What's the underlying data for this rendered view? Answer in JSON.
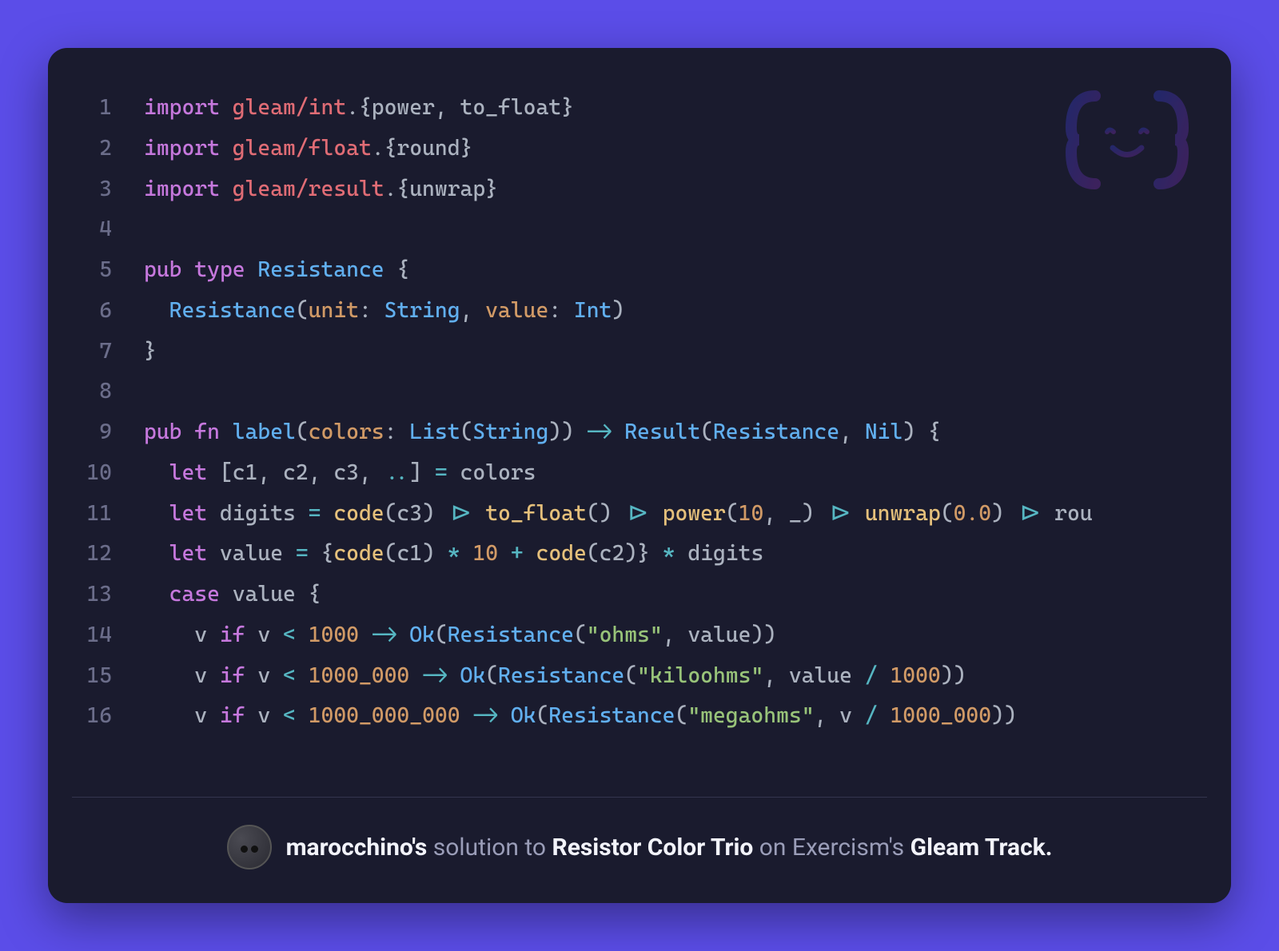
{
  "code": {
    "lines": [
      {
        "n": 1,
        "tokens": [
          {
            "c": "tok-keyword",
            "t": "import"
          },
          {
            "c": "tok-ident",
            "t": " "
          },
          {
            "c": "tok-module",
            "t": "gleam/int"
          },
          {
            "c": "tok-punct",
            "t": ".{"
          },
          {
            "c": "tok-ident",
            "t": "power"
          },
          {
            "c": "tok-punct",
            "t": ", "
          },
          {
            "c": "tok-ident",
            "t": "to_float"
          },
          {
            "c": "tok-punct",
            "t": "}"
          }
        ]
      },
      {
        "n": 2,
        "tokens": [
          {
            "c": "tok-keyword",
            "t": "import"
          },
          {
            "c": "tok-ident",
            "t": " "
          },
          {
            "c": "tok-module",
            "t": "gleam/float"
          },
          {
            "c": "tok-punct",
            "t": ".{"
          },
          {
            "c": "tok-ident",
            "t": "round"
          },
          {
            "c": "tok-punct",
            "t": "}"
          }
        ]
      },
      {
        "n": 3,
        "tokens": [
          {
            "c": "tok-keyword",
            "t": "import"
          },
          {
            "c": "tok-ident",
            "t": " "
          },
          {
            "c": "tok-module",
            "t": "gleam/result"
          },
          {
            "c": "tok-punct",
            "t": ".{"
          },
          {
            "c": "tok-ident",
            "t": "unwrap"
          },
          {
            "c": "tok-punct",
            "t": "}"
          }
        ]
      },
      {
        "n": 4,
        "tokens": []
      },
      {
        "n": 5,
        "tokens": [
          {
            "c": "tok-keyword",
            "t": "pub"
          },
          {
            "c": "tok-ident",
            "t": " "
          },
          {
            "c": "tok-keyword",
            "t": "type"
          },
          {
            "c": "tok-ident",
            "t": " "
          },
          {
            "c": "tok-type",
            "t": "Resistance"
          },
          {
            "c": "tok-ident",
            "t": " "
          },
          {
            "c": "tok-punct",
            "t": "{"
          }
        ]
      },
      {
        "n": 6,
        "tokens": [
          {
            "c": "tok-ident",
            "t": "  "
          },
          {
            "c": "tok-type",
            "t": "Resistance"
          },
          {
            "c": "tok-punct",
            "t": "("
          },
          {
            "c": "tok-param",
            "t": "unit"
          },
          {
            "c": "tok-punct",
            "t": ": "
          },
          {
            "c": "tok-type",
            "t": "String"
          },
          {
            "c": "tok-punct",
            "t": ", "
          },
          {
            "c": "tok-param",
            "t": "value"
          },
          {
            "c": "tok-punct",
            "t": ": "
          },
          {
            "c": "tok-type",
            "t": "Int"
          },
          {
            "c": "tok-punct",
            "t": ")"
          }
        ]
      },
      {
        "n": 7,
        "tokens": [
          {
            "c": "tok-punct",
            "t": "}"
          }
        ]
      },
      {
        "n": 8,
        "tokens": []
      },
      {
        "n": 9,
        "tokens": [
          {
            "c": "tok-keyword",
            "t": "pub"
          },
          {
            "c": "tok-ident",
            "t": " "
          },
          {
            "c": "tok-keyword",
            "t": "fn"
          },
          {
            "c": "tok-ident",
            "t": " "
          },
          {
            "c": "tok-func",
            "t": "label"
          },
          {
            "c": "tok-punct",
            "t": "("
          },
          {
            "c": "tok-param",
            "t": "colors"
          },
          {
            "c": "tok-punct",
            "t": ": "
          },
          {
            "c": "tok-type",
            "t": "List"
          },
          {
            "c": "tok-punct",
            "t": "("
          },
          {
            "c": "tok-type",
            "t": "String"
          },
          {
            "c": "tok-punct",
            "t": ")) "
          },
          {
            "c": "tok-op",
            "t": "->"
          },
          {
            "c": "tok-ident",
            "t": " "
          },
          {
            "c": "tok-type",
            "t": "Result"
          },
          {
            "c": "tok-punct",
            "t": "("
          },
          {
            "c": "tok-type",
            "t": "Resistance"
          },
          {
            "c": "tok-punct",
            "t": ", "
          },
          {
            "c": "tok-type",
            "t": "Nil"
          },
          {
            "c": "tok-punct",
            "t": ") {"
          }
        ]
      },
      {
        "n": 10,
        "tokens": [
          {
            "c": "tok-ident",
            "t": "  "
          },
          {
            "c": "tok-keyword",
            "t": "let"
          },
          {
            "c": "tok-ident",
            "t": " "
          },
          {
            "c": "tok-punct",
            "t": "["
          },
          {
            "c": "tok-ident",
            "t": "c1"
          },
          {
            "c": "tok-punct",
            "t": ", "
          },
          {
            "c": "tok-ident",
            "t": "c2"
          },
          {
            "c": "tok-punct",
            "t": ", "
          },
          {
            "c": "tok-ident",
            "t": "c3"
          },
          {
            "c": "tok-punct",
            "t": ", "
          },
          {
            "c": "tok-op",
            "t": ".."
          },
          {
            "c": "tok-punct",
            "t": "] "
          },
          {
            "c": "tok-op",
            "t": "="
          },
          {
            "c": "tok-ident",
            "t": " colors"
          }
        ]
      },
      {
        "n": 11,
        "tokens": [
          {
            "c": "tok-ident",
            "t": "  "
          },
          {
            "c": "tok-keyword",
            "t": "let"
          },
          {
            "c": "tok-ident",
            "t": " digits "
          },
          {
            "c": "tok-op",
            "t": "="
          },
          {
            "c": "tok-ident",
            "t": " "
          },
          {
            "c": "tok-call",
            "t": "code"
          },
          {
            "c": "tok-punct",
            "t": "(c3) "
          },
          {
            "c": "tok-op",
            "t": "|>"
          },
          {
            "c": "tok-ident",
            "t": " "
          },
          {
            "c": "tok-call",
            "t": "to_float"
          },
          {
            "c": "tok-punct",
            "t": "() "
          },
          {
            "c": "tok-op",
            "t": "|>"
          },
          {
            "c": "tok-ident",
            "t": " "
          },
          {
            "c": "tok-call",
            "t": "power"
          },
          {
            "c": "tok-punct",
            "t": "("
          },
          {
            "c": "tok-num",
            "t": "10"
          },
          {
            "c": "tok-punct",
            "t": ", _) "
          },
          {
            "c": "tok-op",
            "t": "|>"
          },
          {
            "c": "tok-ident",
            "t": " "
          },
          {
            "c": "tok-call",
            "t": "unwrap"
          },
          {
            "c": "tok-punct",
            "t": "("
          },
          {
            "c": "tok-num",
            "t": "0.0"
          },
          {
            "c": "tok-punct",
            "t": ") "
          },
          {
            "c": "tok-op",
            "t": "|>"
          },
          {
            "c": "tok-ident",
            "t": " rou"
          }
        ]
      },
      {
        "n": 12,
        "tokens": [
          {
            "c": "tok-ident",
            "t": "  "
          },
          {
            "c": "tok-keyword",
            "t": "let"
          },
          {
            "c": "tok-ident",
            "t": " value "
          },
          {
            "c": "tok-op",
            "t": "="
          },
          {
            "c": "tok-ident",
            "t": " "
          },
          {
            "c": "tok-punct",
            "t": "{"
          },
          {
            "c": "tok-call",
            "t": "code"
          },
          {
            "c": "tok-punct",
            "t": "(c1) "
          },
          {
            "c": "tok-op",
            "t": "*"
          },
          {
            "c": "tok-ident",
            "t": " "
          },
          {
            "c": "tok-num",
            "t": "10"
          },
          {
            "c": "tok-ident",
            "t": " "
          },
          {
            "c": "tok-op",
            "t": "+"
          },
          {
            "c": "tok-ident",
            "t": " "
          },
          {
            "c": "tok-call",
            "t": "code"
          },
          {
            "c": "tok-punct",
            "t": "(c2)} "
          },
          {
            "c": "tok-op",
            "t": "*"
          },
          {
            "c": "tok-ident",
            "t": " digits"
          }
        ]
      },
      {
        "n": 13,
        "tokens": [
          {
            "c": "tok-ident",
            "t": "  "
          },
          {
            "c": "tok-keyword",
            "t": "case"
          },
          {
            "c": "tok-ident",
            "t": " value "
          },
          {
            "c": "tok-punct",
            "t": "{"
          }
        ]
      },
      {
        "n": 14,
        "tokens": [
          {
            "c": "tok-ident",
            "t": "    v "
          },
          {
            "c": "tok-keyword",
            "t": "if"
          },
          {
            "c": "tok-ident",
            "t": " v "
          },
          {
            "c": "tok-op",
            "t": "<"
          },
          {
            "c": "tok-ident",
            "t": " "
          },
          {
            "c": "tok-num",
            "t": "1000"
          },
          {
            "c": "tok-ident",
            "t": " "
          },
          {
            "c": "tok-op",
            "t": "->"
          },
          {
            "c": "tok-ident",
            "t": " "
          },
          {
            "c": "tok-type",
            "t": "Ok"
          },
          {
            "c": "tok-punct",
            "t": "("
          },
          {
            "c": "tok-type",
            "t": "Resistance"
          },
          {
            "c": "tok-punct",
            "t": "("
          },
          {
            "c": "tok-str",
            "t": "\"ohms\""
          },
          {
            "c": "tok-punct",
            "t": ", value))"
          }
        ]
      },
      {
        "n": 15,
        "tokens": [
          {
            "c": "tok-ident",
            "t": "    v "
          },
          {
            "c": "tok-keyword",
            "t": "if"
          },
          {
            "c": "tok-ident",
            "t": " v "
          },
          {
            "c": "tok-op",
            "t": "<"
          },
          {
            "c": "tok-ident",
            "t": " "
          },
          {
            "c": "tok-num",
            "t": "1000_000"
          },
          {
            "c": "tok-ident",
            "t": " "
          },
          {
            "c": "tok-op",
            "t": "->"
          },
          {
            "c": "tok-ident",
            "t": " "
          },
          {
            "c": "tok-type",
            "t": "Ok"
          },
          {
            "c": "tok-punct",
            "t": "("
          },
          {
            "c": "tok-type",
            "t": "Resistance"
          },
          {
            "c": "tok-punct",
            "t": "("
          },
          {
            "c": "tok-str",
            "t": "\"kiloohms\""
          },
          {
            "c": "tok-punct",
            "t": ", value "
          },
          {
            "c": "tok-op",
            "t": "/"
          },
          {
            "c": "tok-ident",
            "t": " "
          },
          {
            "c": "tok-num",
            "t": "1000"
          },
          {
            "c": "tok-punct",
            "t": "))"
          }
        ]
      },
      {
        "n": 16,
        "tokens": [
          {
            "c": "tok-ident",
            "t": "    v "
          },
          {
            "c": "tok-keyword",
            "t": "if"
          },
          {
            "c": "tok-ident",
            "t": " v "
          },
          {
            "c": "tok-op",
            "t": "<"
          },
          {
            "c": "tok-ident",
            "t": " "
          },
          {
            "c": "tok-num",
            "t": "1000_000_000"
          },
          {
            "c": "tok-ident",
            "t": " "
          },
          {
            "c": "tok-op",
            "t": "->"
          },
          {
            "c": "tok-ident",
            "t": " "
          },
          {
            "c": "tok-type",
            "t": "Ok"
          },
          {
            "c": "tok-punct",
            "t": "("
          },
          {
            "c": "tok-type",
            "t": "Resistance"
          },
          {
            "c": "tok-punct",
            "t": "("
          },
          {
            "c": "tok-str",
            "t": "\"megaohms\""
          },
          {
            "c": "tok-punct",
            "t": ", v "
          },
          {
            "c": "tok-op",
            "t": "/"
          },
          {
            "c": "tok-ident",
            "t": " "
          },
          {
            "c": "tok-num",
            "t": "1000_000"
          },
          {
            "c": "tok-punct",
            "t": "))"
          }
        ]
      }
    ]
  },
  "footer": {
    "username": "marocchino's",
    "solution_word": "solution to",
    "exercise": "Resistor Color Trio",
    "on_word": "on Exercism's",
    "track": "Gleam Track."
  }
}
